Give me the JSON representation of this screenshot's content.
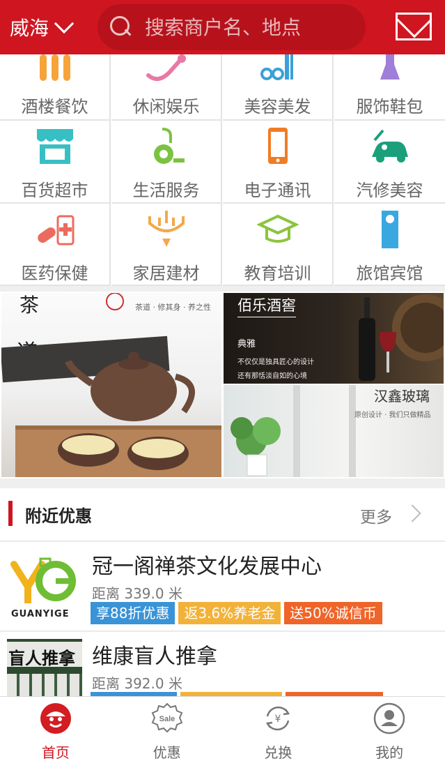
{
  "header": {
    "city": "威海",
    "search_placeholder": "搜索商户名、地点",
    "icons": {
      "city_dropdown": "chevron-down-icon",
      "search": "search-icon",
      "message": "mail-icon"
    },
    "accent_color": "#cf1520"
  },
  "categories": [
    {
      "label": "酒楼餐饮",
      "icon": "tableware-icon"
    },
    {
      "label": "休闲娱乐",
      "icon": "microphone-icon"
    },
    {
      "label": "美容美发",
      "icon": "scissors-comb-icon"
    },
    {
      "label": "服饰鞋包",
      "icon": "dress-icon"
    },
    {
      "label": "百货超市",
      "icon": "store-icon"
    },
    {
      "label": "生活服务",
      "icon": "vacuum-cleaner-icon"
    },
    {
      "label": "电子通讯",
      "icon": "phone-icon"
    },
    {
      "label": "汽修美容",
      "icon": "car-wash-icon"
    },
    {
      "label": "医药保健",
      "icon": "medicine-icon"
    },
    {
      "label": "家居建材",
      "icon": "chandelier-icon"
    },
    {
      "label": "教育培训",
      "icon": "graduation-cap-icon"
    },
    {
      "label": "旅馆宾馆",
      "icon": "door-hanger-icon"
    }
  ],
  "banner": {
    "left_calligraphy": "茶",
    "left_calligraphy_2": "道",
    "left_tagline": "茶道 · 修其身 · 养之性",
    "wine_title": "佰乐酒窖",
    "wine_sub": "典雅",
    "wine_line1": "不仅仅是独具匠心的设计",
    "wine_line2": "还有那恬淡自如的心境",
    "glass_title": "汉鑫玻璃",
    "glass_sub": "原创设计 · 我们只做精品"
  },
  "nearby": {
    "title": "附近优惠",
    "more": "更多",
    "items": [
      {
        "name": "冠一阁禅茶文化发展中心",
        "distance": "距离 339.0 米",
        "logo_text": "GUANYIGE",
        "tags": [
          "享88折优惠",
          "返3.6%养老金",
          "送50%诚信币"
        ]
      },
      {
        "name": "维康盲人推拿",
        "distance": "距离 392.0 米",
        "sign_text": "盲人推拿",
        "tags": [
          "",
          "",
          ""
        ]
      }
    ]
  },
  "bottom_nav": [
    {
      "label": "首页",
      "icon": "home-face-icon",
      "active": true
    },
    {
      "label": "优惠",
      "icon": "sale-badge-icon",
      "active": false,
      "badge": "Sale"
    },
    {
      "label": "兑换",
      "icon": "exchange-icon",
      "active": false,
      "symbol": "¥"
    },
    {
      "label": "我的",
      "icon": "user-icon",
      "active": false
    }
  ]
}
